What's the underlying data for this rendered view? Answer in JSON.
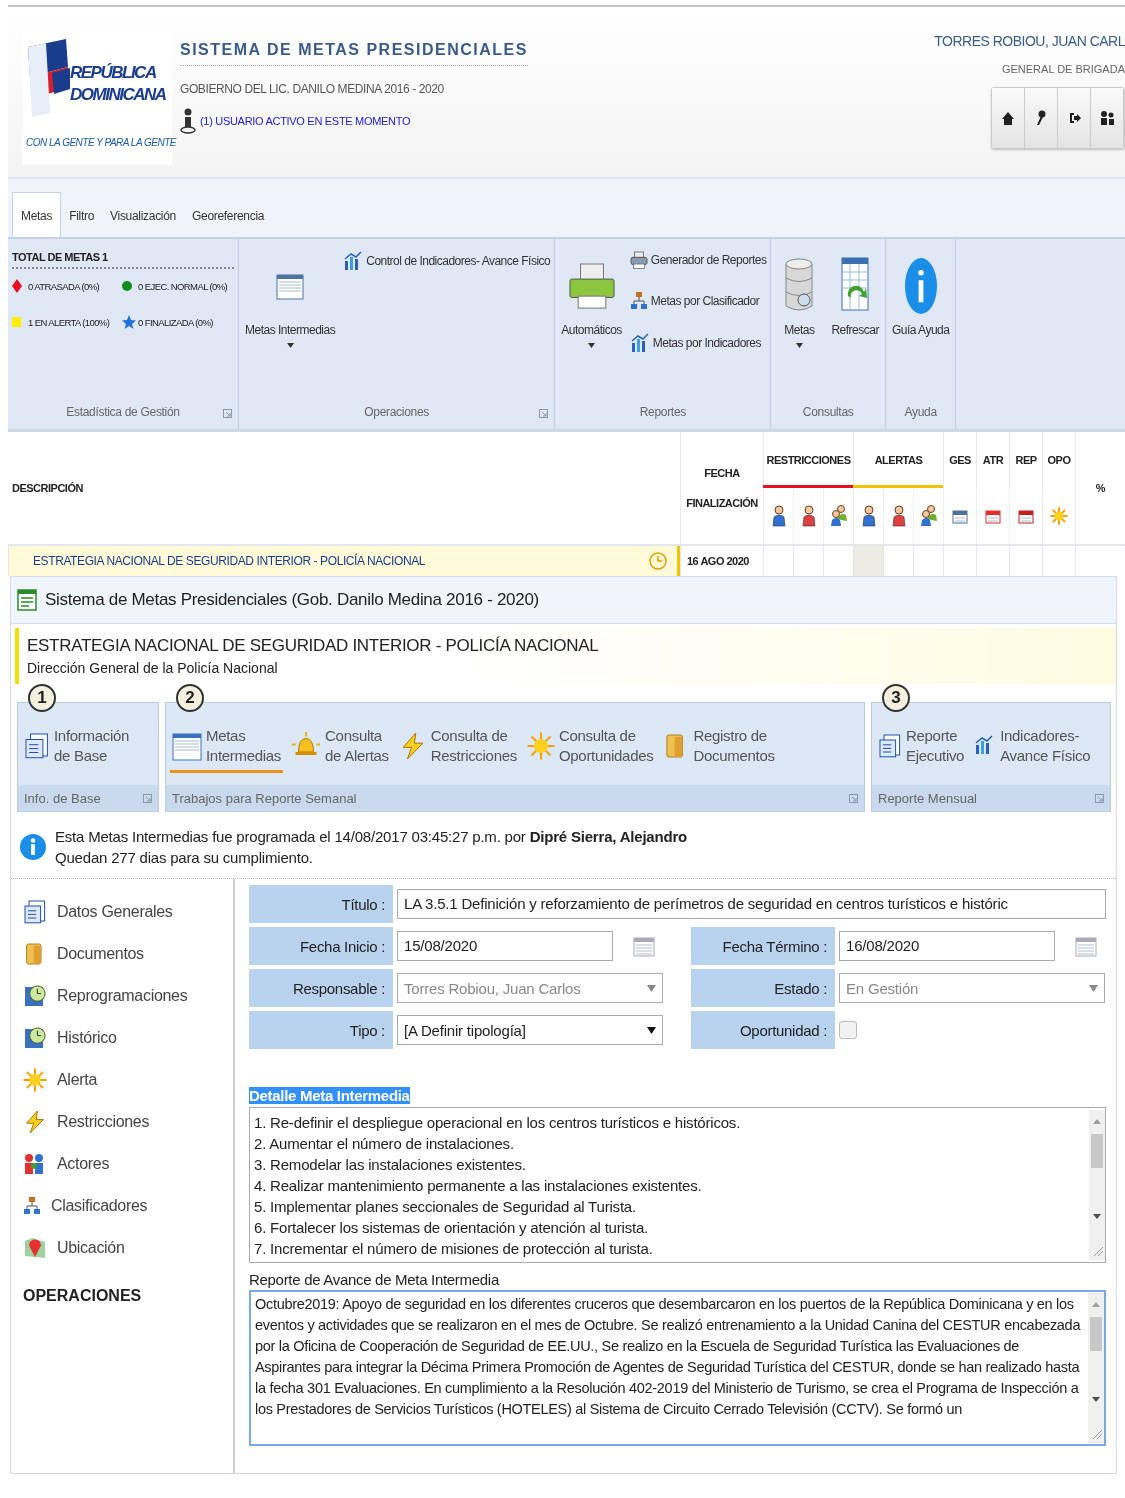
{
  "header": {
    "logo_line1": "REPÚBLICA",
    "logo_line2": "DOMINICANA",
    "logo_slogan": "CON LA GENTE Y PARA LA GENTE",
    "title": "SISTEMA DE METAS PRESIDENCIALES",
    "subtitle": "GOBIERNO DEL LIC. DANILO MEDINA 2016 - 2020",
    "active_users": "(1) USUARIO ACTIVO EN ESTE MOMENTO",
    "user_name": "TORRES ROBIOU, JUAN CARL",
    "user_rank": "GENERAL DE BRIGADA"
  },
  "ribbon": {
    "tabs": [
      {
        "label": "Metas",
        "selected": true
      },
      {
        "label": "Filtro",
        "selected": false
      },
      {
        "label": "Visualización",
        "selected": false
      },
      {
        "label": "Georeferencia",
        "selected": false
      }
    ],
    "groups": [
      {
        "label": "Estadística de Gestión",
        "launcher": true,
        "kind": "stats",
        "total": "TOTAL DE METAS 1",
        "stats": [
          {
            "label": "0 ATRASADA (0%)",
            "kind": "diamond",
            "color": "#e81020"
          },
          {
            "label": "0 EJEC. NORMAL (0%)",
            "kind": "circle",
            "color": "#109020"
          },
          {
            "label": "1 EN ALERTA (100%)",
            "kind": "square",
            "color": "#ffee00"
          },
          {
            "label": "0 FINALIZADA (0%)",
            "kind": "star",
            "color": "#2070e0"
          }
        ]
      },
      {
        "label": "Operaciones",
        "launcher": true,
        "kind": "buttons",
        "large": [
          {
            "label": "Metas Intermedias",
            "dropdown": true
          }
        ],
        "small": [
          {
            "label": "Control de Indicadores- Avance Físico"
          }
        ]
      },
      {
        "label": "Reportes",
        "launcher": false,
        "kind": "buttons",
        "large": [
          {
            "label": "Automáticos",
            "dropdown": true
          }
        ],
        "small": [
          {
            "label": "Generador de Reportes"
          },
          {
            "label": "Metas por Clasificador"
          },
          {
            "label": "Metas por Indicadores"
          }
        ]
      },
      {
        "label": "Consultas",
        "launcher": false,
        "kind": "buttons",
        "large": [
          {
            "label": "Metas",
            "dropdown": true
          },
          {
            "label": "Refrescar",
            "dropdown": false
          }
        ]
      },
      {
        "label": "Ayuda",
        "launcher": false,
        "kind": "buttons",
        "large": [
          {
            "label": "Guía Ayuda",
            "dropdown": false
          }
        ]
      }
    ]
  },
  "table": {
    "description_header": "DESCRIPCIÓN",
    "date_header": "FECHA FINALIZACIÓN",
    "groups": [
      {
        "label": "RESTRICCIONES",
        "color": "#e81020"
      },
      {
        "label": "ALERTAS",
        "color": "#f0c400"
      },
      {
        "label": "GES"
      },
      {
        "label": "ATR"
      },
      {
        "label": "REP"
      },
      {
        "label": "OPO"
      }
    ],
    "percent_header": "%",
    "rows": [
      {
        "description": "ESTRATEGIA NACIONAL DE SEGURIDAD INTERIOR - POLICÍA NACIONAL",
        "date": "16 AGO 2020",
        "highlighted": true
      }
    ]
  },
  "dialog": {
    "title": "Sistema de Metas Presidenciales (Gob. Danilo Medina 2016 - 2020)",
    "heading": "ESTRATEGIA NACIONAL DE SEGURIDAD INTERIOR - POLICÍA NACIONAL",
    "subheading": "Dirección General de la Policía Nacional",
    "modules": [
      {
        "badge": "1",
        "footer": "Info. de Base",
        "items": [
          {
            "label": "Información\nde Base",
            "selected": false
          }
        ]
      },
      {
        "badge": "2",
        "footer": "Trabajos para Reporte Semanal",
        "items": [
          {
            "label": "Metas\nIntermedias",
            "selected": true
          },
          {
            "label": "Consulta\nde Alertas",
            "selected": false
          },
          {
            "label": "Consulta de\nRestricciones",
            "selected": false
          },
          {
            "label": "Consulta de\nOportunidades",
            "selected": false
          },
          {
            "label": "Registro de\nDocumentos",
            "selected": false
          }
        ]
      },
      {
        "badge": "3",
        "footer": "Reporte Mensual",
        "items": [
          {
            "label": "Reporte\nEjecutivo",
            "selected": false
          },
          {
            "label": "Indicadores-\nAvance Físico",
            "selected": false
          }
        ]
      }
    ],
    "info": [
      "Esta Metas Intermedias fue programada el 14/08/2017 03:45:27 p.m. por **Dipré Sierra, Alejandro**",
      "Quedan 277 dias para su cumplimiento."
    ],
    "nav": [
      "Datos Generales",
      "Documentos",
      "Reprogramaciones",
      "Histórico",
      "Alerta",
      "Restricciones",
      "Actores",
      "Clasificadores",
      "Ubicación"
    ],
    "nav_heading": "OPERACIONES",
    "form": [
      {
        "fields": [
          {
            "label": "Título :",
            "value": "LA 3.5.1 Definición y reforzamiento de perímetros de seguridad en centros turísticos e históric",
            "kind": "text",
            "disabled": false
          }
        ]
      },
      {
        "fields": [
          {
            "label": "Fecha Inicio :",
            "value": "15/08/2020",
            "kind": "date",
            "disabled": false
          },
          {
            "label": "Fecha Término :",
            "value": "16/08/2020",
            "kind": "date",
            "disabled": false
          }
        ]
      },
      {
        "fields": [
          {
            "label": "Responsable :",
            "value": "Torres Robiou, Juan Carlos",
            "kind": "select",
            "disabled": true
          },
          {
            "label": "Estado :",
            "value": "En Gestión",
            "kind": "select",
            "disabled": true
          }
        ]
      },
      {
        "fields": [
          {
            "label": "Tipo :",
            "value": "[A Definir tipología]",
            "kind": "select",
            "disabled": false
          },
          {
            "label": "Oportunidad :",
            "kind": "checkbox",
            "checked": false,
            "disabled": true
          }
        ]
      }
    ],
    "detail": {
      "label": "Detalle Meta Intermedia",
      "highlighted": true,
      "lines": [
        "1. Re-definir el despliegue operacional en los centros turísticos e históricos.",
        "2. Aumentar el número de instalaciones.",
        "3. Remodelar las instalaciones existentes.",
        "4. Realizar mantenimiento permanente a las instalaciones existentes.",
        "5. Implementar planes seccionales de Seguridad al Turista.",
        "6. Fortalecer los sistemas de orientación y atención al turista.",
        "7. Incrementar el número de misiones de protección al turista."
      ]
    },
    "report": {
      "label": "Reporte de Avance de Meta Intermedia",
      "focused": true,
      "text": "Octubre2019: Apoyo de seguridad en los diferentes cruceros que desembarcaron en los puertos de la República Dominicana y en los eventos y actividades que se realizaron en el mes de Octubre. Se realizó entrenamiento a la Unidad Canina del CESTUR encabezada por la Oficina de Cooperación de Seguridad de EE.UU., Se realizo en la Escuela de Seguridad Turística las Evaluaciones de Aspirantes para integrar la Décima Primera Promoción de Agentes de Seguridad Turística del CESTUR, donde se han realizado hasta la fecha 301 Evaluaciones. En cumplimiento a la Resolución 402-2019 del Ministerio de Turismo, se crea el Programa de Inspección a los Prestadores de Servicios Turísticos (HOTELES) al Sistema de Circuito Cerrado Televisión (CCTV). Se formó un"
    }
  }
}
